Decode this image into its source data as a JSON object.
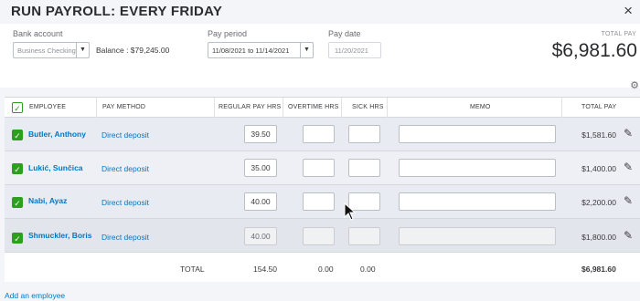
{
  "title": "RUN PAYROLL: EVERY FRIDAY",
  "close_icon": "×",
  "bank_account": {
    "label": "Bank account",
    "value": "Business Checking",
    "balance": "Balance : $79,245.00"
  },
  "pay_period": {
    "label": "Pay period",
    "value": "11/08/2021 to 11/14/2021"
  },
  "pay_date": {
    "label": "Pay date",
    "value": "11/20/2021"
  },
  "total_pay": {
    "label": "TOTAL PAY",
    "value": "$6,981.60"
  },
  "columns": {
    "employee": "EMPLOYEE",
    "pay_method": "PAY METHOD",
    "regular_hrs": "REGULAR PAY HRS",
    "overtime_hrs": "OVERTIME HRS",
    "sick_hrs": "SICK HRS",
    "memo": "MEMO",
    "total_pay": "TOTAL PAY"
  },
  "employees": [
    {
      "name": "Butler, Anthony",
      "pay_method": "Direct deposit",
      "regular_hrs": "39.50",
      "total": "$1,581.60"
    },
    {
      "name": "Lukić, Sunčica",
      "pay_method": "Direct deposit",
      "regular_hrs": "35.00",
      "total": "$1,400.00"
    },
    {
      "name": "Nabi, Ayaz",
      "pay_method": "Direct deposit",
      "regular_hrs": "40.00",
      "total": "$2,200.00"
    },
    {
      "name": "Shmuckler, Boris",
      "pay_method": "Direct deposit",
      "regular_hrs": "40.00",
      "total": "$1,800.00"
    }
  ],
  "totals": {
    "label": "TOTAL",
    "regular_hrs": "154.50",
    "overtime_hrs": "0.00",
    "sick_hrs": "0.00",
    "total_pay": "$6,981.60"
  },
  "add_employee": "Add an employee",
  "colors": {
    "accent_green": "#2ca01c",
    "link_blue": "#0077c5"
  }
}
